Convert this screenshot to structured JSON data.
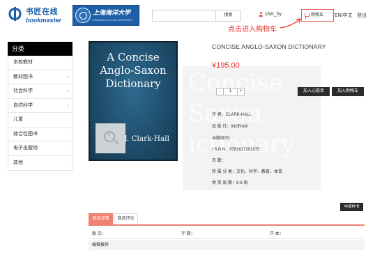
{
  "header": {
    "logo_cn": "书匠在线",
    "logo_en": "bookmaster",
    "partner_logo_cn": "上海海洋大学",
    "partner_logo_en": "SHANGHAI OCEAN UNIVERSITY",
    "search_placeholder": "",
    "search_button": "搜索",
    "username": "shzt_hy",
    "cart_label": "购物车",
    "language": "EN/中文",
    "logout": "登出",
    "annotation": "点击进入购物车",
    "annotation_color": "#e8312a"
  },
  "sidebar": {
    "title": "分类",
    "items": [
      {
        "label": "本校教材",
        "has_arrow": false
      },
      {
        "label": "教材图书",
        "has_arrow": true
      },
      {
        "label": "社会科学",
        "has_arrow": true
      },
      {
        "label": "自然科学",
        "has_arrow": true
      },
      {
        "label": "儿童",
        "has_arrow": false
      },
      {
        "label": "综合性图书",
        "has_arrow": false
      },
      {
        "label": "电子出版物",
        "has_arrow": false
      },
      {
        "label": "其他",
        "has_arrow": false
      }
    ]
  },
  "product": {
    "cover_title_lines": [
      "A Concise",
      "Anglo-Saxon",
      "Dictionary"
    ],
    "cover_author": "J. Clark-Hall",
    "watermark_lines": [
      "Concise",
      "Saxon",
      "ictionary"
    ],
    "title": "CONCISE ANGLO-SAXON DICTIONARY",
    "price": "¥195.00",
    "price_color": "#e8312a",
    "quantity": "1",
    "qty_minus": "-",
    "qty_plus": "+",
    "wishlist_button": "加入心愿单",
    "cart_button": "加入购物车",
    "info": {
      "author": "作 者：CLARK-HALL",
      "publisher": "出 版 社：INGRAM",
      "pub_date": "出版时间：",
      "isbn": "I S B N：9781617201875",
      "pages": "页 数：",
      "category": "所 属 分 类：文化、科学、教育、体育",
      "supply_cycle": "供 货 周 期：6-8 周"
    },
    "sample_button": "申请样书"
  },
  "tabs": {
    "items": [
      "商品详情",
      "商品评论"
    ],
    "active_color": "#f08070",
    "edition_label": "版 次：",
    "words_label": "字 数：",
    "format_label": "开 本：",
    "editor_recommend": "编辑推荐"
  }
}
